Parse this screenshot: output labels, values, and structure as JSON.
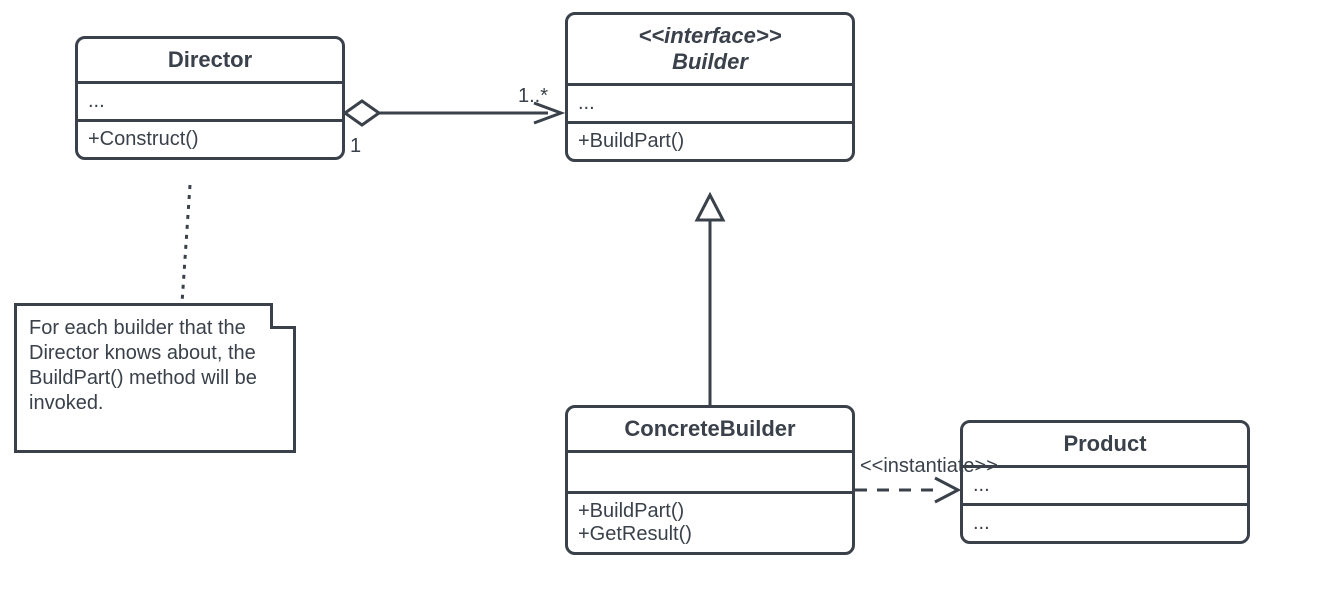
{
  "director": {
    "title": "Director",
    "attrs": "...",
    "ops": "+Construct()"
  },
  "builder": {
    "stereotype": "<<interface>>",
    "title": "Builder",
    "attrs": "...",
    "ops": "+BuildPart()"
  },
  "concrete": {
    "title": "ConcreteBuilder",
    "op1": "+BuildPart()",
    "op2": "+GetResult()"
  },
  "product": {
    "title": "Product",
    "attrs": "...",
    "ops": "..."
  },
  "note": {
    "text": "For each builder that the Director knows about, the BuildPart() method will be invoked."
  },
  "labels": {
    "mult_left": "1",
    "mult_right": "1..*",
    "instantiate": "<<instantiate>>"
  }
}
